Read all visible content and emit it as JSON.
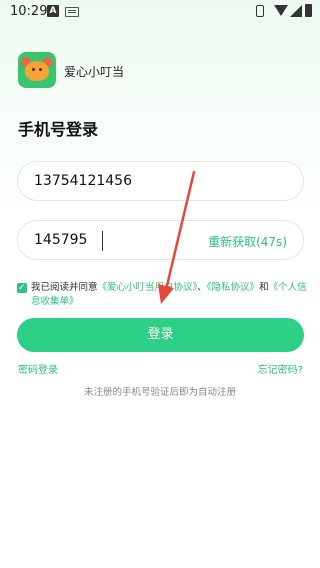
{
  "status_bar": {
    "time": "10:29",
    "notif_badge": "A"
  },
  "app": {
    "name": "爱心小叮当"
  },
  "page_title": "手机号登录",
  "phone_input": {
    "value": "13754121456"
  },
  "code_input": {
    "value": "145795",
    "resend_label": "重新获取(47s)"
  },
  "agreement": {
    "prefix": "我已阅读并同意",
    "link_user": "《爱心小叮当用户协议》",
    "sep1": "、",
    "link_privacy": "《隐私协议》",
    "and": "和",
    "link_personal": "《个人信息收集单》"
  },
  "login_button": "登录",
  "password_login": "密码登录",
  "forgot_password": "忘记密码?",
  "footer_note": "未注册的手机号验证后即为自动注册",
  "colors": {
    "accent": "#2ecf86",
    "link": "#2ec27e",
    "arrow": "#e8453c"
  }
}
